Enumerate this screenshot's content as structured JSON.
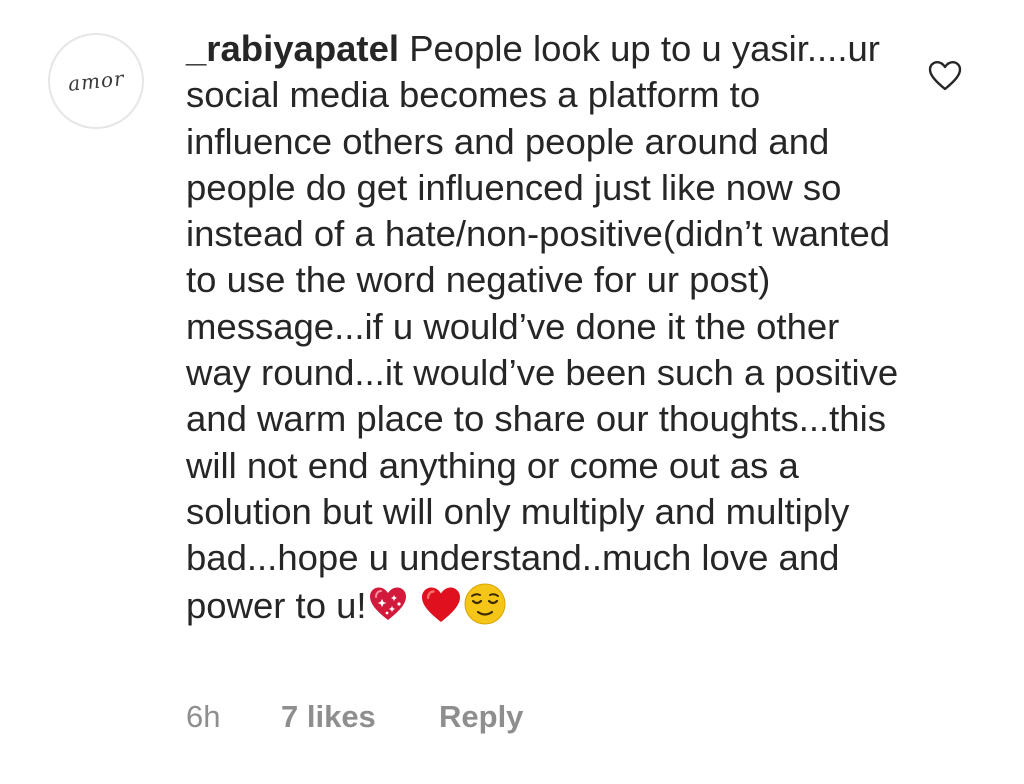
{
  "comment": {
    "avatar": {
      "text": "amor",
      "icon": "avatar"
    },
    "username": "_rabiyapatel",
    "text": "People look up to u yasir....ur social media becomes a platform to influence others and people around and people do get influenced just like now so instead of a hate/non-positive(didn’t wanted to use the word negative for ur post) message...if u would’ve done it the other way round...it would’ve been such a positive and warm place to share our thoughts...this will not end anything or come out as a solution but will only multiply and multiply bad...hope u understand..much love and power to u!",
    "emojis": [
      "sparkling-heart-icon",
      "red-heart-icon",
      "relieved-face-icon"
    ],
    "like_icon": "heart-outline-icon",
    "meta": {
      "time": "6h",
      "likes": "7 likes",
      "reply": "Reply"
    }
  },
  "colors": {
    "text": "#262626",
    "meta": "#8e8e8e",
    "heart_red": "#e0101e",
    "sparkle_heart": "#d11a3c",
    "face_yellow": "#f5c518"
  }
}
